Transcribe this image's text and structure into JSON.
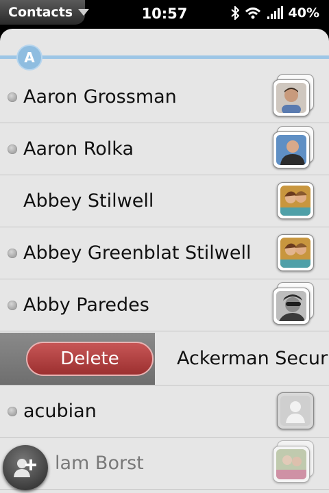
{
  "status_bar": {
    "app_menu_label": "Contacts",
    "time": "10:57",
    "battery": "40%"
  },
  "section": {
    "letter": "A"
  },
  "contacts": [
    {
      "name": "Aaron Grossman",
      "linked": true
    },
    {
      "name": "Aaron Rolka",
      "linked": true
    },
    {
      "name": "Abbey Stilwell",
      "linked": false
    },
    {
      "name": "Abbey Greenblat Stilwell",
      "linked": true
    },
    {
      "name": "Abby Paredes",
      "linked": true
    }
  ],
  "delete_row": {
    "button_label": "Delete",
    "name": "Ackerman Securi"
  },
  "contacts_after": [
    {
      "name": "acubian",
      "linked": true
    },
    {
      "name": "lam Borst",
      "linked": false
    }
  ],
  "colors": {
    "divider": "#9dc6e6",
    "delete": "#b94545"
  }
}
